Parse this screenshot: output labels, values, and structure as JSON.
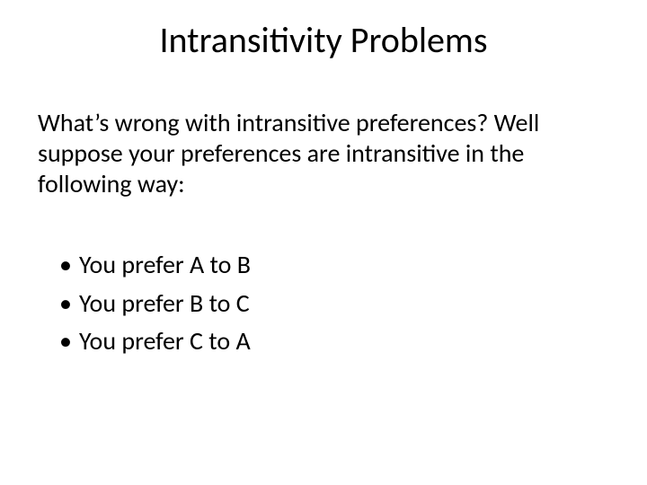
{
  "title": "Intransitivity Problems",
  "body": {
    "paragraph": "What’s wrong with intransitive preferences? Well suppose your preferences are intransitive in the following way:",
    "bullets": [
      "You prefer A to B",
      "You prefer B to C",
      "You prefer C to A"
    ]
  }
}
